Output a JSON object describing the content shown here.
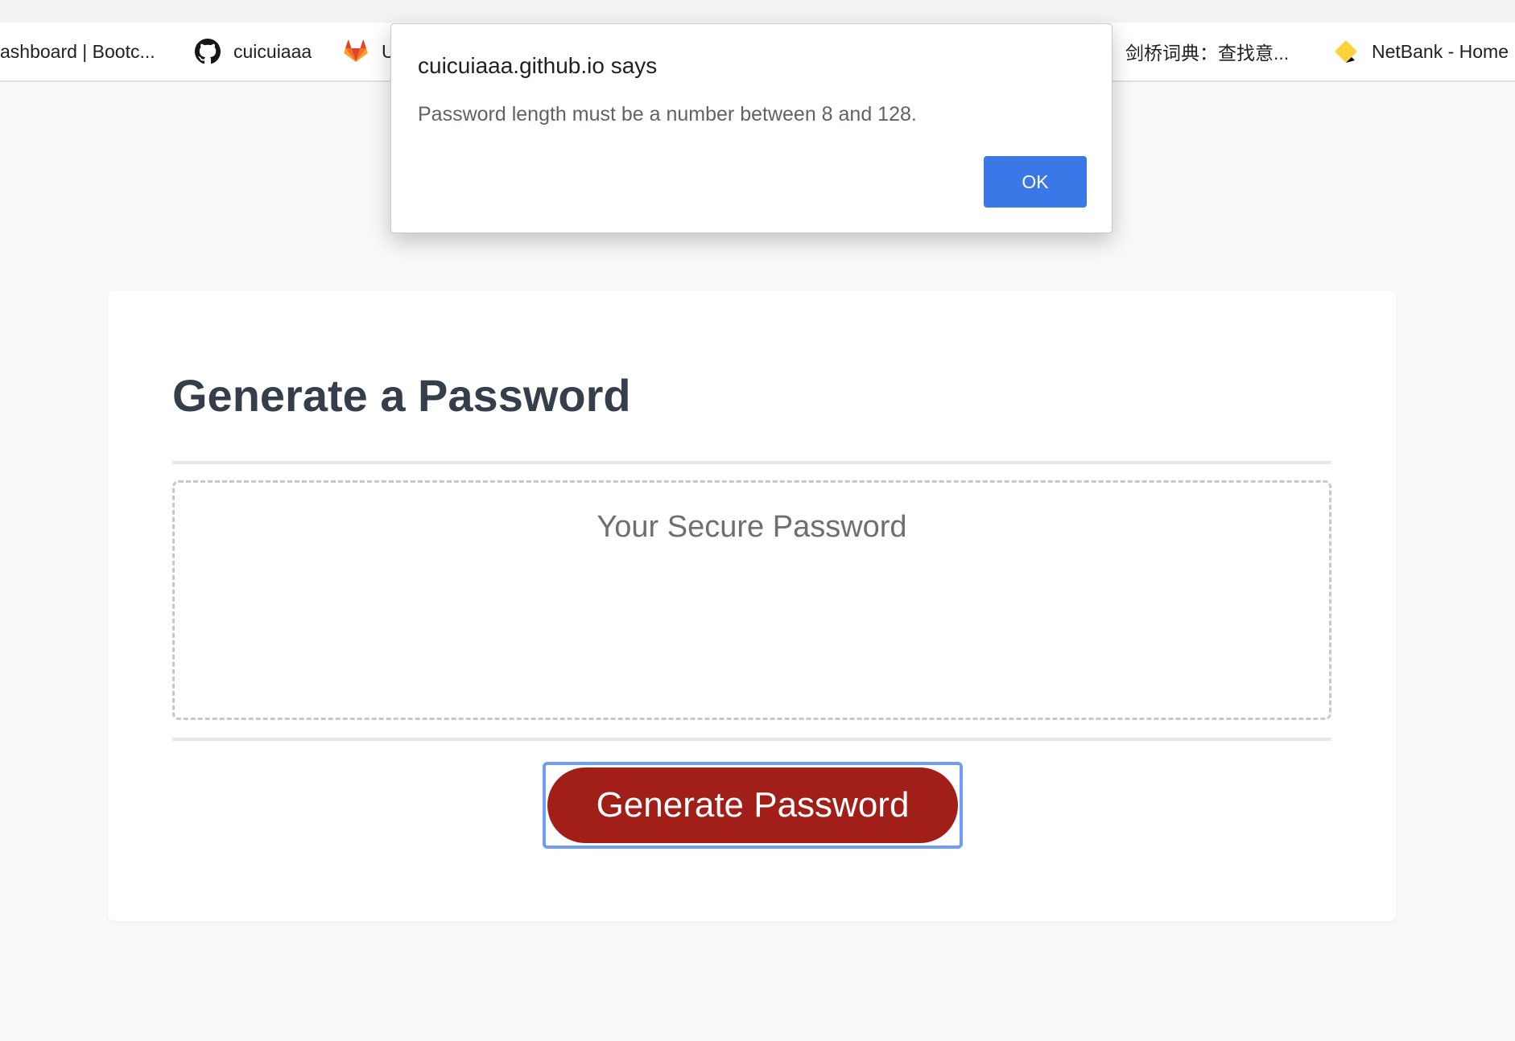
{
  "bookmarks": {
    "items": [
      {
        "label": "ashboard | Bootc..."
      },
      {
        "label": "cuicuiaaa"
      },
      {
        "label": "U"
      },
      {
        "label": "剑桥词典：查找意..."
      },
      {
        "label": "NetBank - Home"
      }
    ]
  },
  "card": {
    "title": "Generate a Password",
    "password_placeholder": "Your Secure Password",
    "generate_label": "Generate Password"
  },
  "dialog": {
    "title": "cuicuiaaa.github.io says",
    "message": "Password length must be a number between 8 and 128.",
    "ok_label": "OK"
  },
  "colors": {
    "generate_button": "#a21f19",
    "ok_button": "#3b78e7",
    "heading": "#343f4b"
  }
}
